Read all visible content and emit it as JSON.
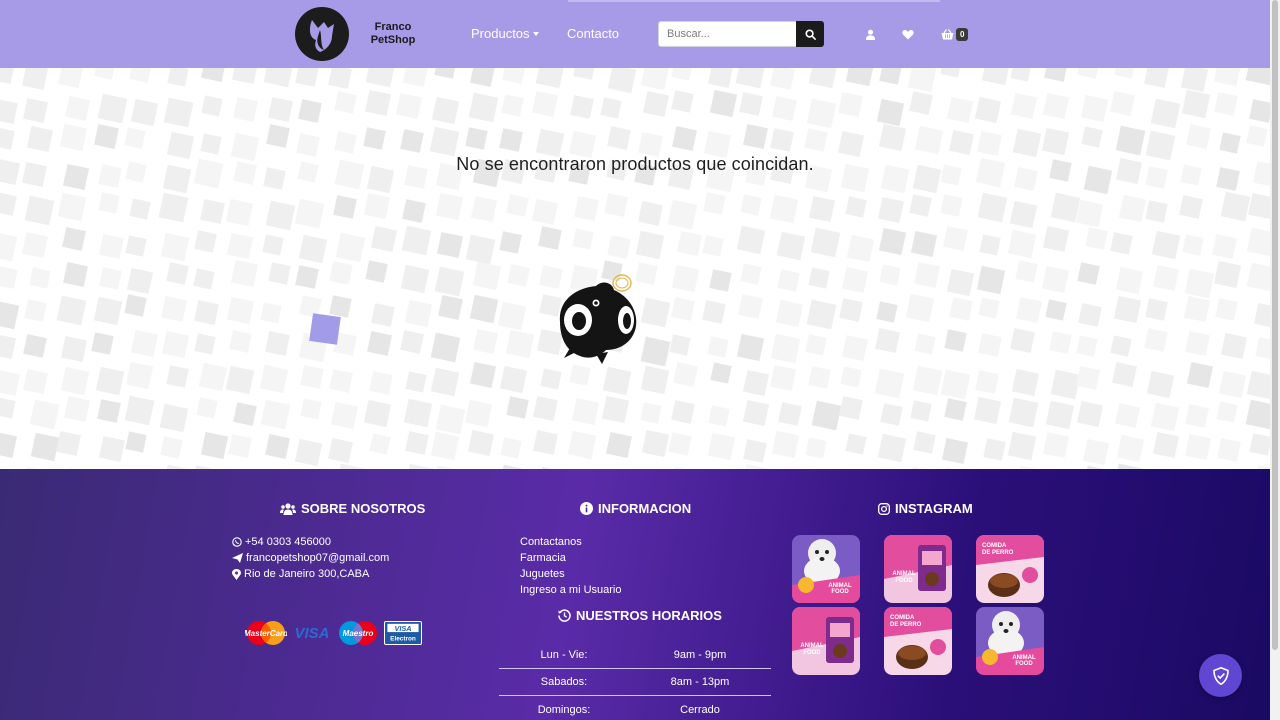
{
  "brand": {
    "name_line1": "Franco",
    "name_line2": "PetShop"
  },
  "nav": {
    "productos": "Productos",
    "contacto": "Contacto",
    "search_placeholder": "Buscar...",
    "cart_count": "0"
  },
  "main": {
    "message": "No se encontraron productos que coincidan."
  },
  "footer": {
    "sobre": {
      "title": "SOBRE NOSOTROS",
      "phone": "+54 0303 456000",
      "email": "francopetshop07@gmail.com",
      "address": "Rio de Janeiro 300,CABA"
    },
    "info": {
      "title": "INFORMACION",
      "links": [
        "Contactanos",
        "Farmacia",
        "Juguetes",
        "Ingreso a mi Usuario"
      ]
    },
    "horarios": {
      "title": "NUESTROS HORARIOS",
      "rows": [
        {
          "day": "Lun - Vie:",
          "time": "9am - 9pm"
        },
        {
          "day": "Sabados:",
          "time": "8am - 13pm"
        },
        {
          "day": "Domingos:",
          "time": "Cerrado"
        }
      ]
    },
    "instagram": {
      "title": "INSTAGRAM"
    },
    "payment_cards": [
      "MasterCard",
      "VISA",
      "Maestro",
      "VISA Electron"
    ]
  },
  "colors": {
    "navbar": "#a79ae7",
    "footer_start": "#3a2a74",
    "footer_end": "#1a0a63",
    "accent": "#5f47d4"
  }
}
